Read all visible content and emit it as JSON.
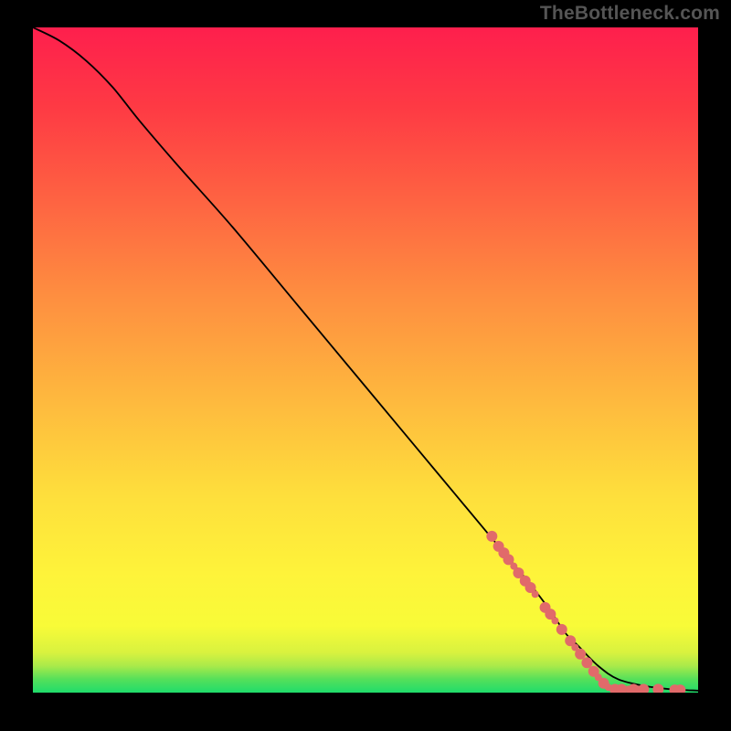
{
  "watermark": "TheBottleneck.com",
  "chart_data": {
    "type": "line",
    "title": "",
    "xlabel": "",
    "ylabel": "",
    "xlim": [
      0,
      100
    ],
    "ylim": [
      0,
      100
    ],
    "grid": false,
    "gradient_stops": [
      {
        "pos": 0.0,
        "color": "#1fdc6b"
      },
      {
        "pos": 0.02,
        "color": "#55e05a"
      },
      {
        "pos": 0.04,
        "color": "#a9ea4a"
      },
      {
        "pos": 0.06,
        "color": "#d8f23f"
      },
      {
        "pos": 0.1,
        "color": "#f8fb38"
      },
      {
        "pos": 0.18,
        "color": "#fef33a"
      },
      {
        "pos": 0.3,
        "color": "#fede3c"
      },
      {
        "pos": 0.45,
        "color": "#feb63e"
      },
      {
        "pos": 0.6,
        "color": "#fe8d40"
      },
      {
        "pos": 0.75,
        "color": "#fe6042"
      },
      {
        "pos": 0.88,
        "color": "#fe3a44"
      },
      {
        "pos": 1.0,
        "color": "#fe1f4d"
      }
    ],
    "series": [
      {
        "name": "curve",
        "color": "#000000",
        "x": [
          0,
          4,
          8,
          12,
          16,
          22,
          30,
          40,
          50,
          60,
          70,
          75,
          78,
          80,
          82,
          85,
          88,
          92,
          96,
          100
        ],
        "y": [
          100,
          98,
          95,
          91,
          86,
          79,
          70,
          58,
          46,
          34,
          22,
          16,
          12,
          9,
          7,
          4,
          2,
          1,
          0.5,
          0.3
        ]
      }
    ],
    "scatter": {
      "name": "points",
      "color": "#e16a6a",
      "radius_small": 4,
      "radius_large": 6,
      "points": [
        {
          "x": 69.0,
          "y": 23.5,
          "r": 6
        },
        {
          "x": 70.0,
          "y": 22.0,
          "r": 6
        },
        {
          "x": 70.8,
          "y": 21.0,
          "r": 6
        },
        {
          "x": 71.5,
          "y": 20.0,
          "r": 6
        },
        {
          "x": 72.3,
          "y": 19.0,
          "r": 4
        },
        {
          "x": 73.0,
          "y": 18.0,
          "r": 6
        },
        {
          "x": 74.0,
          "y": 16.8,
          "r": 6
        },
        {
          "x": 74.8,
          "y": 15.8,
          "r": 6
        },
        {
          "x": 75.5,
          "y": 14.8,
          "r": 4
        },
        {
          "x": 77.0,
          "y": 12.8,
          "r": 6
        },
        {
          "x": 77.8,
          "y": 11.8,
          "r": 6
        },
        {
          "x": 78.5,
          "y": 10.8,
          "r": 4
        },
        {
          "x": 79.5,
          "y": 9.5,
          "r": 6
        },
        {
          "x": 80.8,
          "y": 7.8,
          "r": 6
        },
        {
          "x": 81.5,
          "y": 6.8,
          "r": 4
        },
        {
          "x": 82.3,
          "y": 5.8,
          "r": 6
        },
        {
          "x": 83.3,
          "y": 4.5,
          "r": 6
        },
        {
          "x": 84.3,
          "y": 3.2,
          "r": 6
        },
        {
          "x": 85.0,
          "y": 2.3,
          "r": 4
        },
        {
          "x": 85.8,
          "y": 1.4,
          "r": 6
        },
        {
          "x": 86.5,
          "y": 0.8,
          "r": 4
        },
        {
          "x": 87.5,
          "y": 0.5,
          "r": 6
        },
        {
          "x": 88.5,
          "y": 0.5,
          "r": 6
        },
        {
          "x": 89.5,
          "y": 0.5,
          "r": 4
        },
        {
          "x": 90.3,
          "y": 0.5,
          "r": 6
        },
        {
          "x": 91.0,
          "y": 0.5,
          "r": 4
        },
        {
          "x": 91.8,
          "y": 0.5,
          "r": 6
        },
        {
          "x": 94.0,
          "y": 0.5,
          "r": 6
        },
        {
          "x": 96.5,
          "y": 0.4,
          "r": 6
        },
        {
          "x": 97.3,
          "y": 0.4,
          "r": 6
        }
      ]
    }
  }
}
